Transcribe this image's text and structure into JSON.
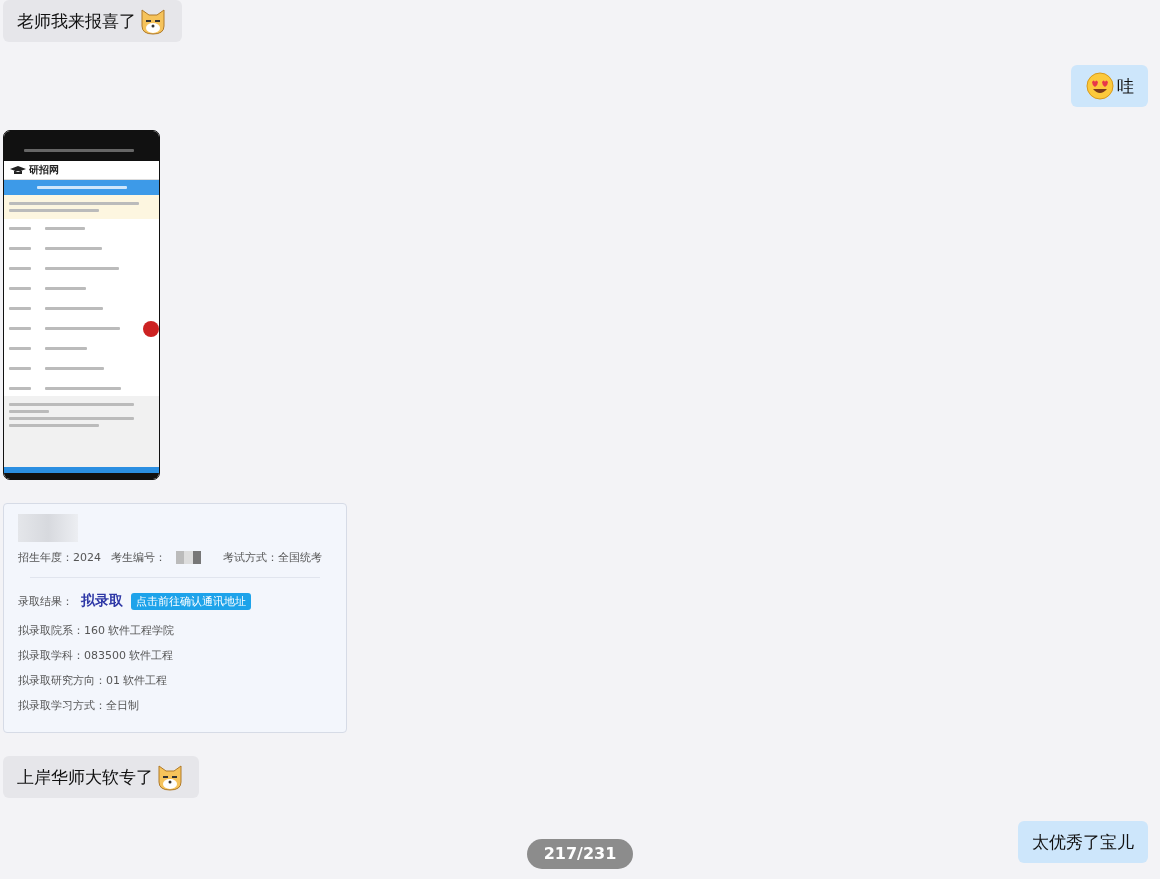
{
  "messages": [
    {
      "kind": "text",
      "outgoing": false,
      "parts": [
        {
          "kind": "text",
          "text": "老师我来报喜了"
        },
        {
          "kind": "cat-emoji"
        }
      ]
    },
    {
      "kind": "text",
      "outgoing": true,
      "parts": [
        {
          "kind": "heart-eyes-emoji"
        },
        {
          "kind": "text",
          "text": "哇"
        }
      ]
    },
    {
      "kind": "phone-screenshot",
      "outgoing": false,
      "site_name": "研招网"
    },
    {
      "kind": "admission-card",
      "outgoing": false,
      "fields": [
        {
          "label": "招生年度：",
          "value": "2024"
        },
        {
          "label": "考生编号："
        },
        {
          "label": "考试方式：",
          "value": "全国统考"
        }
      ],
      "result_label": "录取结果：",
      "result": "拟录取",
      "result_button": "点击前往确认通讯地址",
      "details": [
        "拟录取院系：160 软件工程学院",
        "拟录取学科：083500 软件工程",
        "拟录取研究方向：01 软件工程",
        "拟录取学习方式：全日制"
      ]
    },
    {
      "kind": "text",
      "outgoing": false,
      "parts": [
        {
          "kind": "text",
          "text": "上岸华师大软专了"
        },
        {
          "kind": "cat-emoji"
        }
      ]
    },
    {
      "kind": "text",
      "outgoing": true,
      "parts": [
        {
          "kind": "text",
          "text": "太优秀了宝儿"
        }
      ]
    }
  ],
  "page_counter": "217/231"
}
